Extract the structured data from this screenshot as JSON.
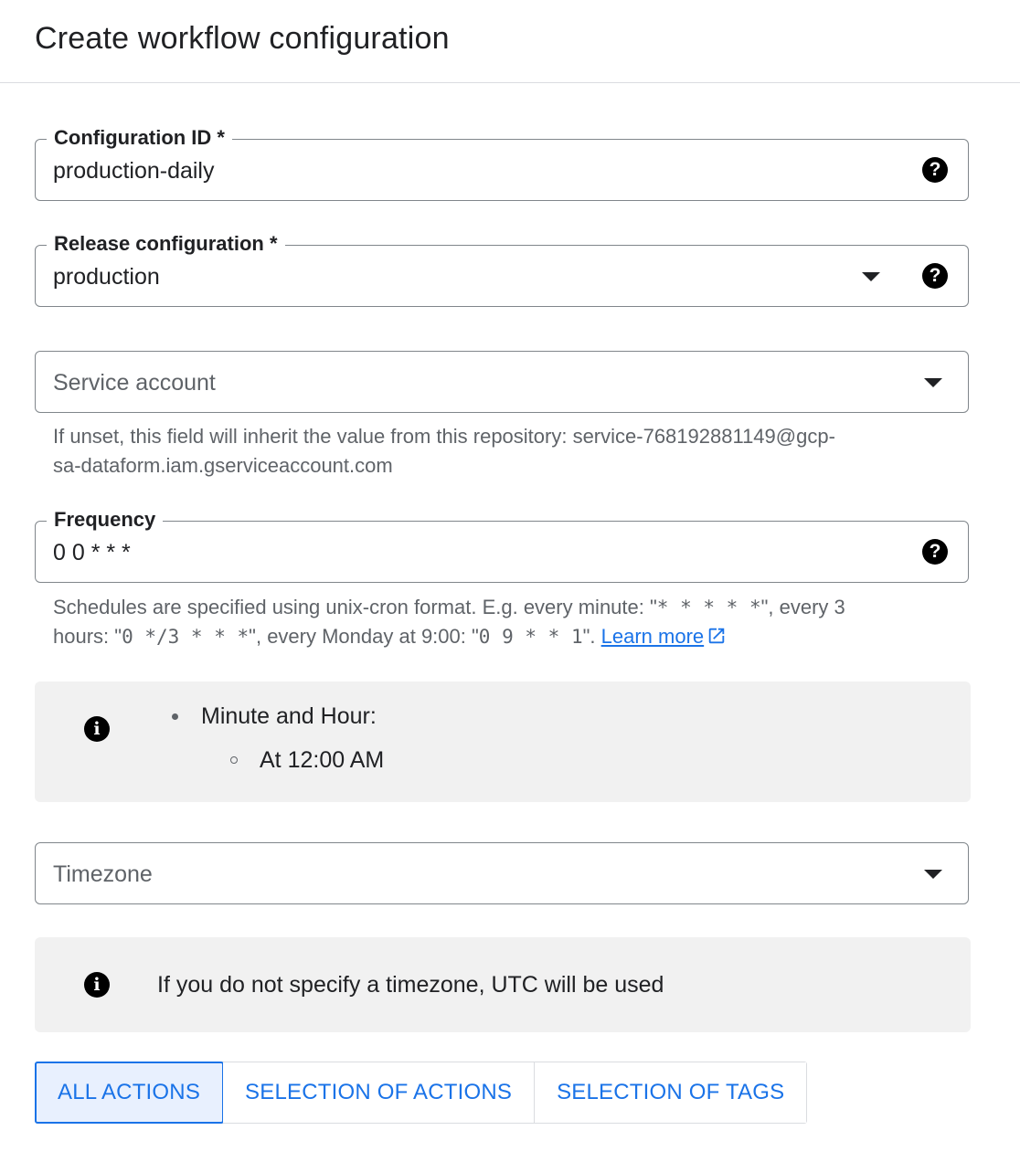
{
  "header": {
    "title": "Create workflow configuration"
  },
  "config_id": {
    "label": "Configuration ID *",
    "value": "production-daily",
    "help_icon": "help-icon"
  },
  "release_config": {
    "label": "Release configuration *",
    "value": "production",
    "dropdown_icon": "arrow-drop-down-icon",
    "help_icon": "help-icon"
  },
  "service_account": {
    "placeholder": "Service account",
    "dropdown_icon": "arrow-drop-down-icon",
    "hint_line1": "If unset, this field will inherit the value from this repository: service-768192881149@gcp-",
    "hint_line2": "sa-dataform.iam.gserviceaccount.com"
  },
  "frequency": {
    "label": "Frequency",
    "value": "0 0 * * *",
    "help_icon": "help-icon",
    "hint": {
      "p1": "Schedules are specified using unix-cron format. E.g. every minute: \"",
      "code1": "* * * * *",
      "p2": "\", every 3",
      "p3": "hours: \"",
      "code2": "0 */3 * * *",
      "p4": "\", every Monday at 9:00: \"",
      "code3": "0 9 * * 1",
      "p5": "\". ",
      "link": "Learn more",
      "link_icon": "open-in-new-icon"
    }
  },
  "schedule_info": {
    "icon": "info-icon",
    "item": "Minute and Hour:",
    "subitem": "At 12:00 AM"
  },
  "timezone": {
    "placeholder": "Timezone",
    "dropdown_icon": "arrow-drop-down-icon"
  },
  "timezone_info": {
    "icon": "info-icon",
    "text": "If you do not specify a timezone, UTC will be used"
  },
  "actions_toggle": {
    "options": [
      "ALL ACTIONS",
      "SELECTION OF ACTIONS",
      "SELECTION OF TAGS"
    ],
    "selected": "ALL ACTIONS"
  },
  "colors": {
    "accent": "#1a73e8",
    "selected_bg": "#e8f0fe",
    "info_bg": "#f1f1f1",
    "border": "#80868b",
    "hint_text": "#5f6368"
  }
}
